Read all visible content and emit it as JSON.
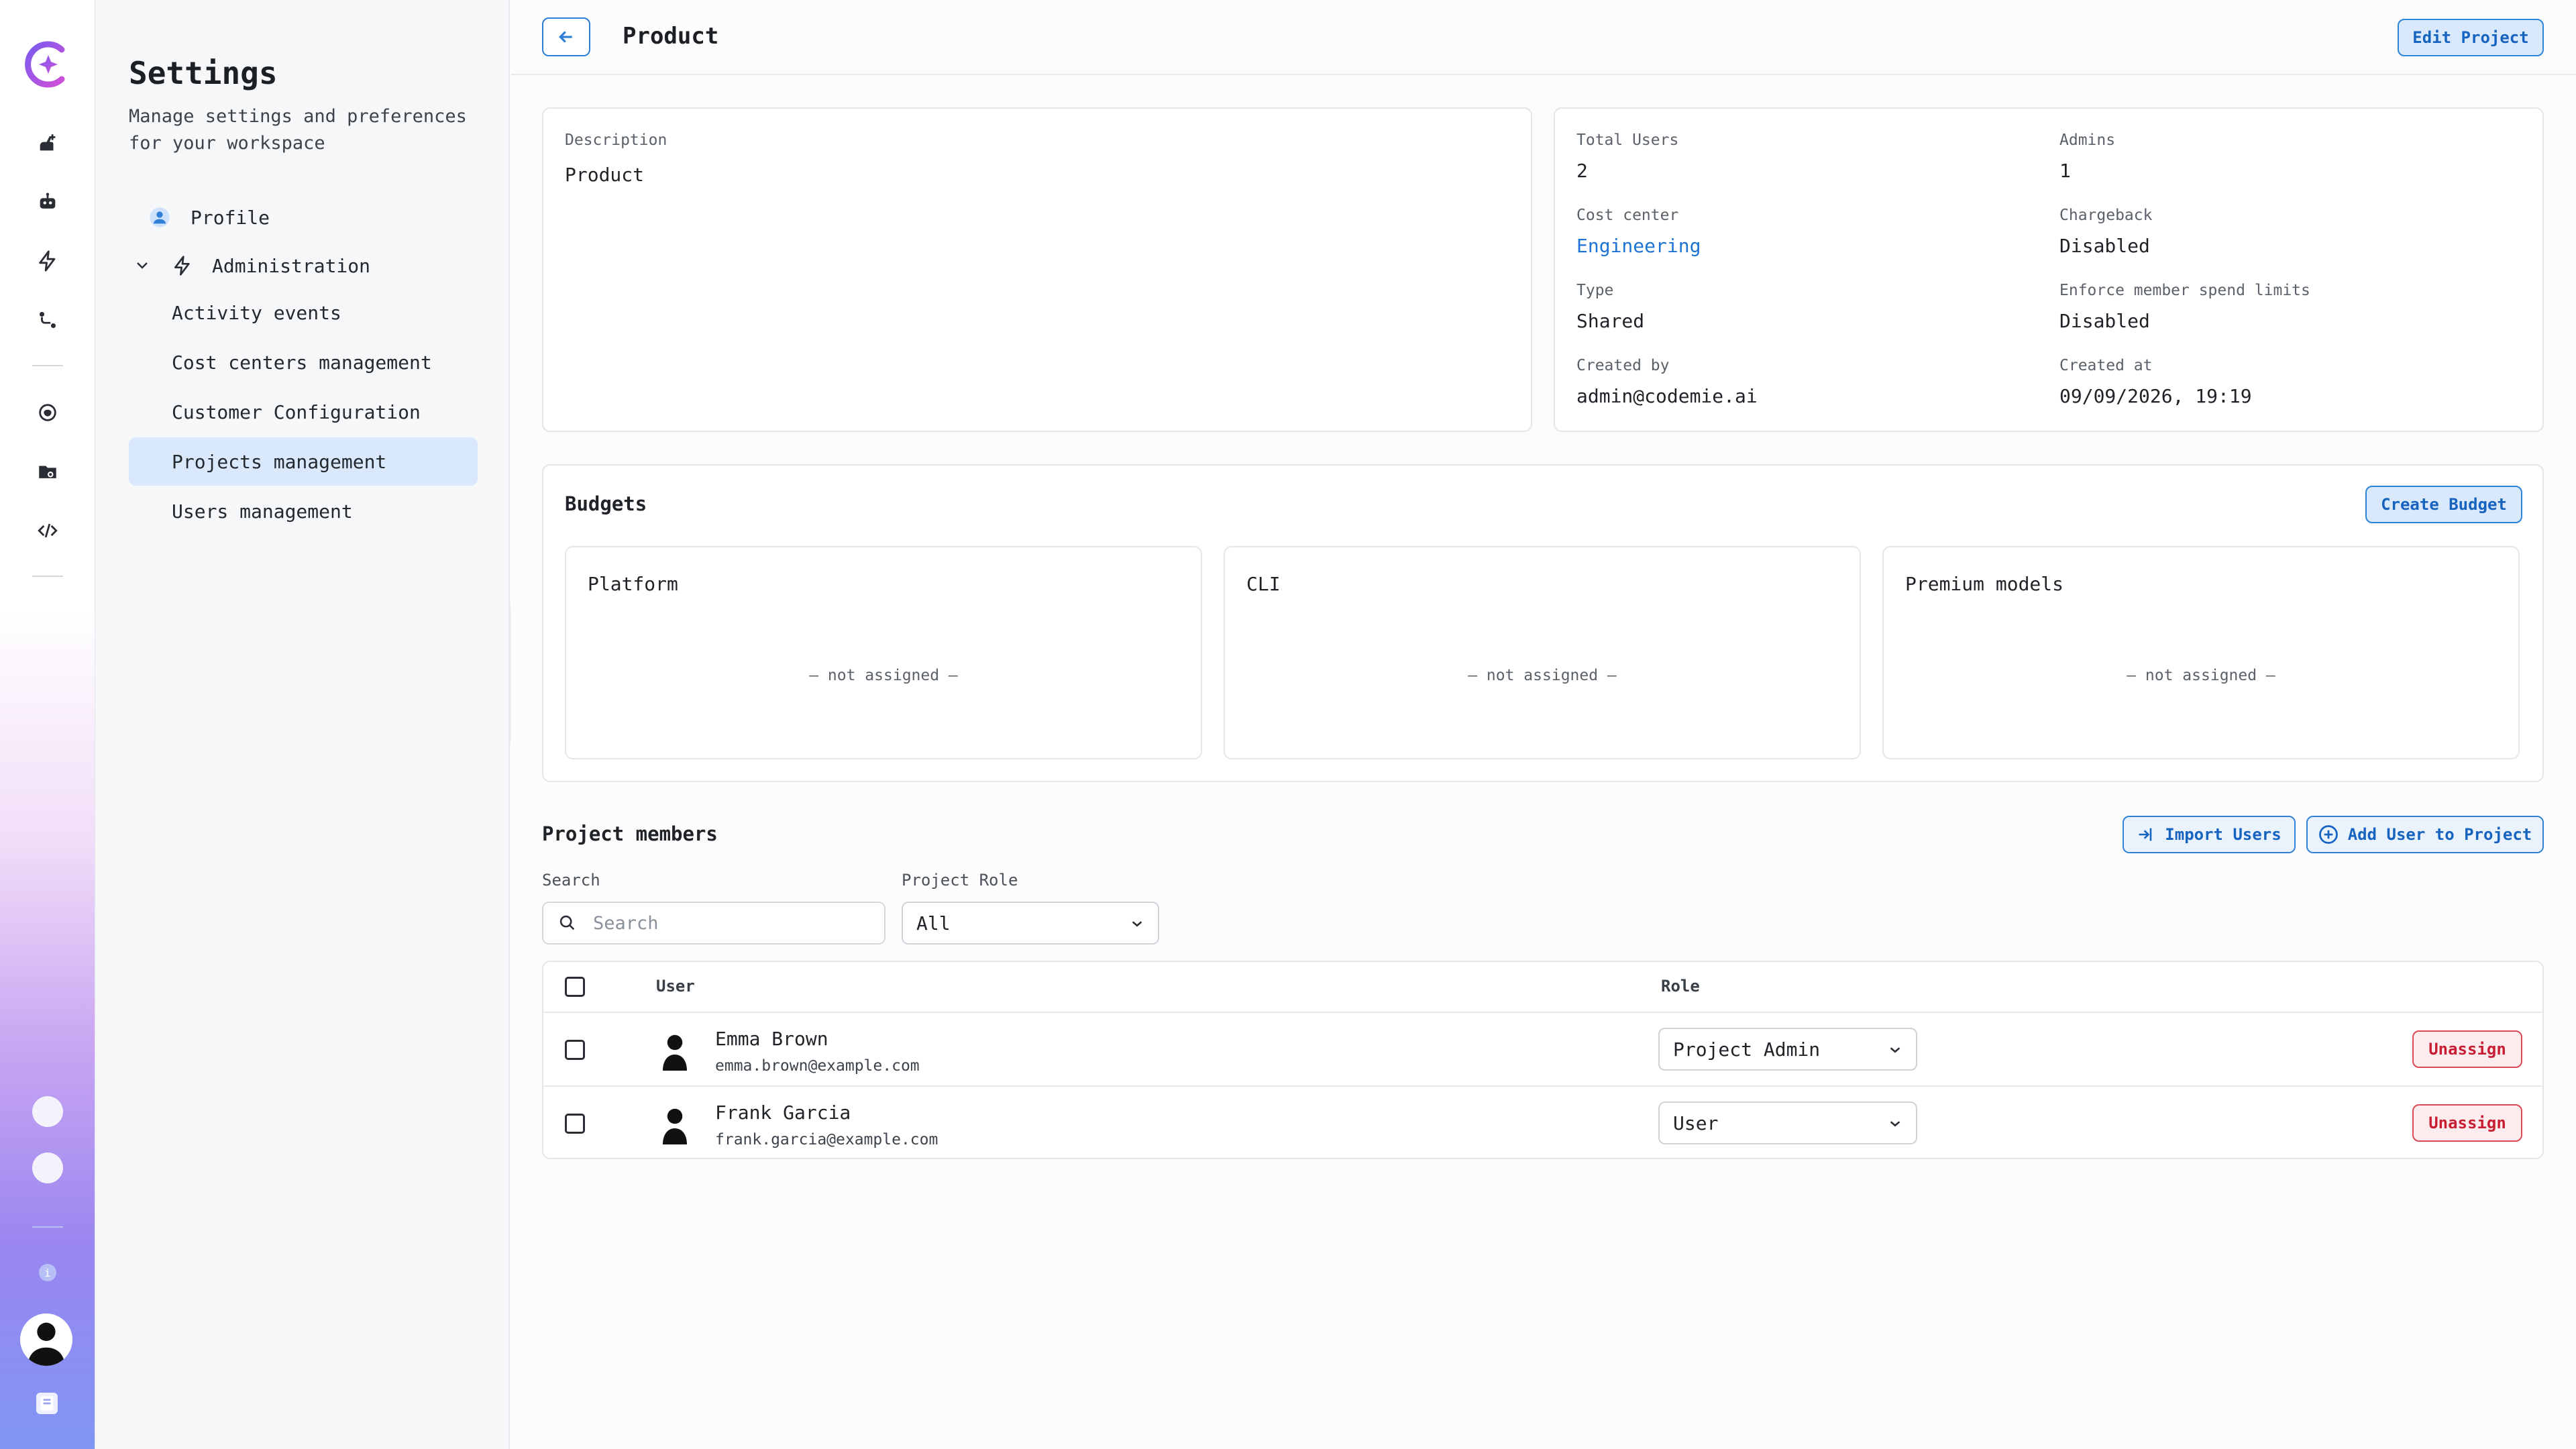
{
  "app": {
    "rail_icons": [
      "logo-icon",
      "add-assistant-icon",
      "robot-icon",
      "bolt-icon",
      "workflow-icon",
      "brain-icon",
      "folder-data-icon",
      "code-icon"
    ],
    "info_label": "i"
  },
  "sidebar": {
    "title": "Settings",
    "subtitle": "Manage settings and preferences for your workspace",
    "items": [
      {
        "label": "Profile"
      },
      {
        "label": "Administration"
      },
      {
        "label": "Activity events"
      },
      {
        "label": "Cost centers management"
      },
      {
        "label": "Customer Configuration"
      },
      {
        "label": "Projects management"
      },
      {
        "label": "Users management"
      }
    ]
  },
  "header": {
    "title": "Product",
    "edit_label": "Edit Project"
  },
  "details": {
    "description_label": "Description",
    "description_value": "Product",
    "total_users_label": "Total Users",
    "total_users_value": "2",
    "admins_label": "Admins",
    "admins_value": "1",
    "cost_center_label": "Cost center",
    "cost_center_value": "Engineering",
    "chargeback_label": "Chargeback",
    "chargeback_value": "Disabled",
    "type_label": "Type",
    "type_value": "Shared",
    "enforce_label": "Enforce member spend limits",
    "enforce_value": "Disabled",
    "created_by_label": "Created by",
    "created_by_value": "admin@codemie.ai",
    "created_at_label": "Created at",
    "created_at_value": "09/09/2026, 19:19"
  },
  "budgets": {
    "title": "Budgets",
    "create_label": "Create Budget",
    "cards": [
      {
        "title": "Platform",
        "status": "— not assigned —"
      },
      {
        "title": "CLI",
        "status": "— not assigned —"
      },
      {
        "title": "Premium models",
        "status": "— not assigned —"
      }
    ]
  },
  "members": {
    "title": "Project members",
    "import_label": "Import Users",
    "add_label": "Add User to Project",
    "search_label": "Search",
    "search_placeholder": "Search",
    "role_filter_label": "Project Role",
    "role_filter_value": "All",
    "columns": {
      "user": "User",
      "role": "Role"
    },
    "rows": [
      {
        "name": "Emma Brown",
        "email": "emma.brown@example.com",
        "role": "Project Admin",
        "action": "Unassign"
      },
      {
        "name": "Frank Garcia",
        "email": "frank.garcia@example.com",
        "role": "User",
        "action": "Unassign"
      }
    ]
  },
  "colors": {
    "accent": "#2f82d8",
    "accent_bg": "#d9e8fb",
    "danger": "#c81e33",
    "danger_bg": "#fdecee",
    "link": "#1d74d4"
  }
}
